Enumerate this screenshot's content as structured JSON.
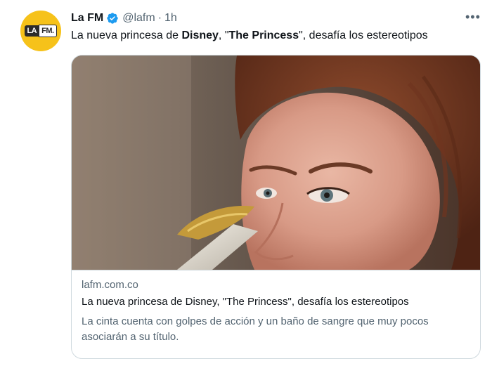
{
  "tweet": {
    "author_name": "La FM",
    "handle": "@lafm",
    "separator": "·",
    "time": "1h",
    "more_icon": "more-icon",
    "avatar": {
      "logo_left": "LA",
      "logo_right": "FM."
    },
    "text_parts": {
      "p1": "La nueva princesa de ",
      "p2": "Disney",
      "p3": ", \"",
      "p4": "The Princess",
      "p5": "\", desafía los estereotipos"
    },
    "card": {
      "domain": "lafm.com.co",
      "title": "La nueva princesa de Disney, \"The Princess\", desafía los estereotipos",
      "description": "La cinta cuenta con golpes de acción y un baño de sangre que muy pocos asociarán a su título."
    }
  },
  "colors": {
    "verified": "#1d9bf0",
    "avatar_bg": "#f6c21a",
    "secondary_text": "#536471",
    "border": "#cfd9de"
  }
}
